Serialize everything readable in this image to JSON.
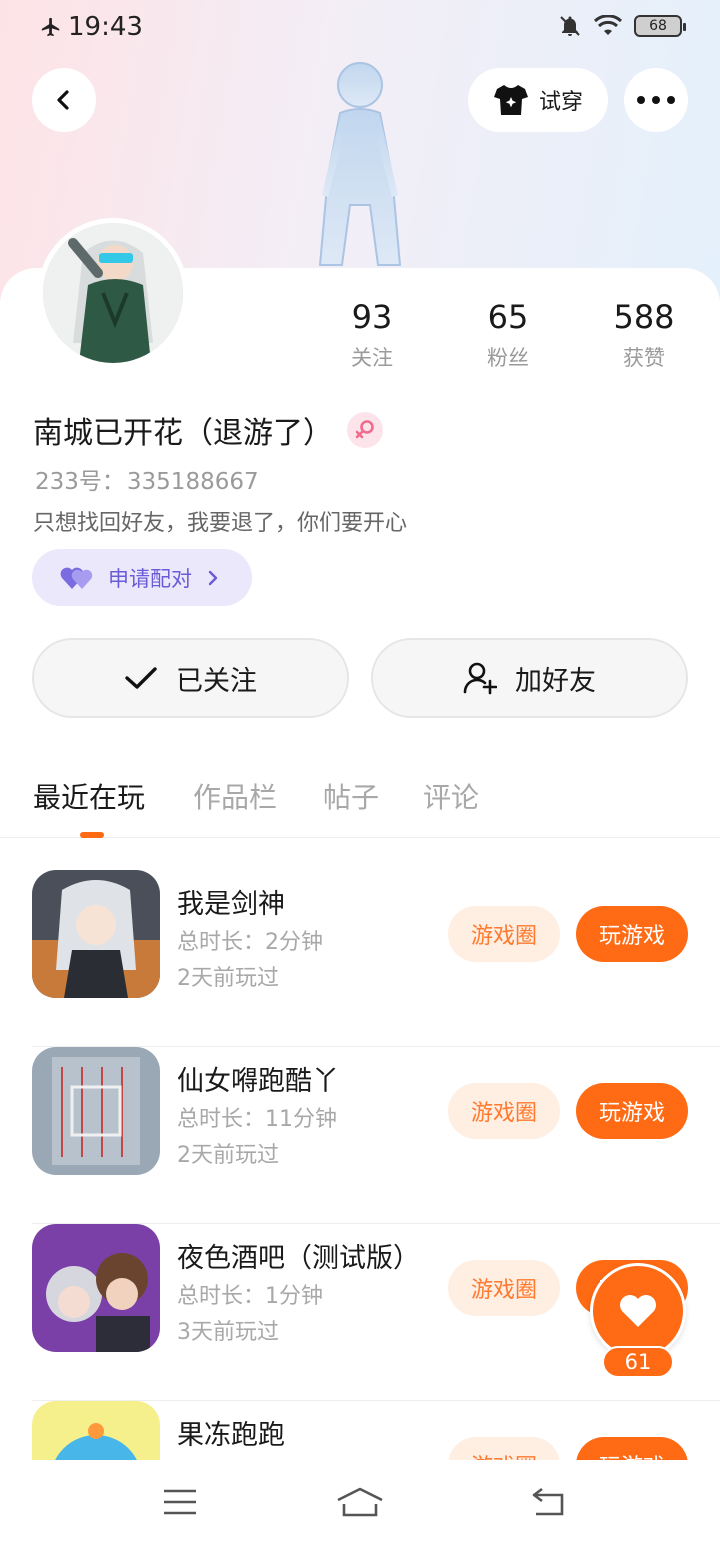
{
  "status_bar": {
    "time": "19:43",
    "battery": "68",
    "icons": [
      "airplane-icon",
      "bell-off-icon",
      "wifi-icon",
      "battery-icon"
    ]
  },
  "header": {
    "try_on_label": "试穿"
  },
  "profile": {
    "stats": [
      {
        "value": "93",
        "label": "关注"
      },
      {
        "value": "65",
        "label": "粉丝"
      },
      {
        "value": "588",
        "label": "获赞"
      }
    ],
    "username": "南城已开花（退游了）",
    "gender": "female",
    "uid_label": "233号：",
    "uid_value": "335188667",
    "bio": "只想找回好友，我要退了，你们要开心",
    "pair_label": "申请配对",
    "follow_label": "已关注",
    "add_friend_label": "加好友"
  },
  "tabs": [
    {
      "label": "最近在玩",
      "active": true
    },
    {
      "label": "作品栏",
      "active": false
    },
    {
      "label": "帖子",
      "active": false
    },
    {
      "label": "评论",
      "active": false
    }
  ],
  "games": [
    {
      "name": "我是剑神",
      "duration": "总时长：2分钟",
      "last_played": "2天前玩过",
      "circle_label": "游戏圈",
      "play_label": "玩游戏"
    },
    {
      "name": "仙女嘚跑酷丫",
      "duration": "总时长：11分钟",
      "last_played": "2天前玩过",
      "circle_label": "游戏圈",
      "play_label": "玩游戏"
    },
    {
      "name": "夜色酒吧（测试版）",
      "duration": "总时长：1分钟",
      "last_played": "3天前玩过",
      "circle_label": "游戏圈",
      "play_label": "玩游戏"
    },
    {
      "name": "果冻跑跑",
      "duration": "",
      "last_played": "",
      "circle_label": "游戏圈",
      "play_label": "玩游戏"
    }
  ],
  "like_float": {
    "count": "61"
  },
  "colors": {
    "accent": "#ff6a14",
    "accent_light": "#ffeee2",
    "pair": "#6a5bd6"
  }
}
